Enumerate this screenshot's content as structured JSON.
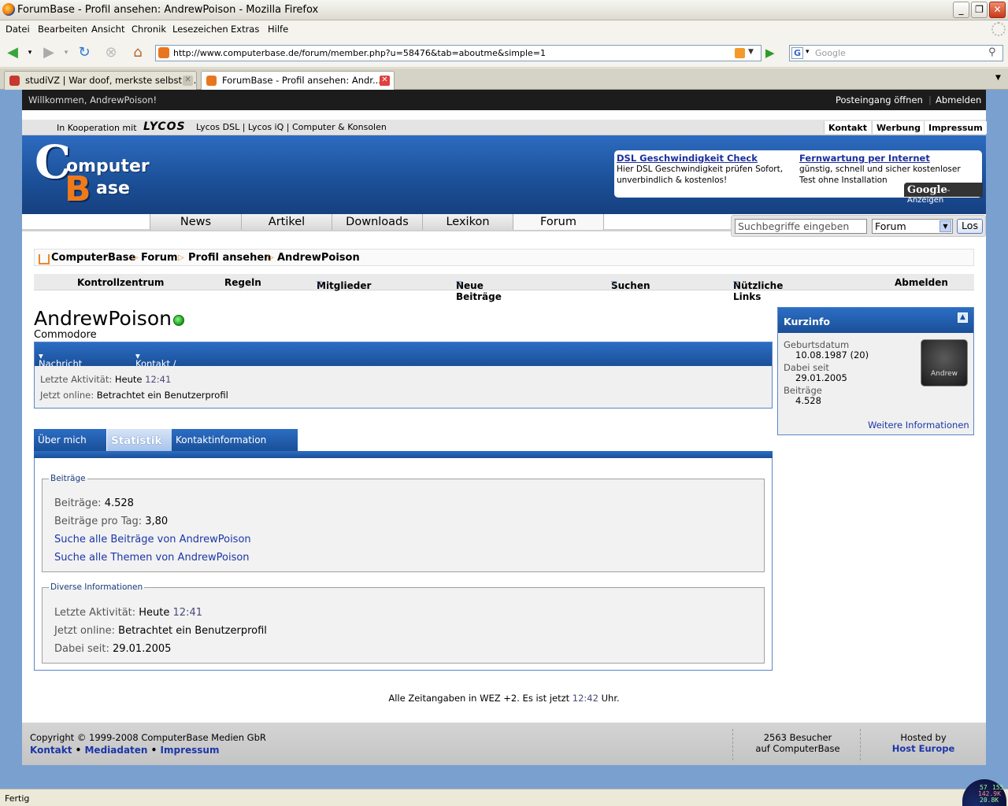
{
  "window": {
    "title": "ForumBase - Profil ansehen: AndrewPoison - Mozilla Firefox"
  },
  "menu": [
    "Datei",
    "Bearbeiten",
    "Ansicht",
    "Chronik",
    "Lesezeichen",
    "Extras",
    "Hilfe"
  ],
  "toolbar": {
    "url": "http://www.computerbase.de/forum/member.php?u=58476&tab=aboutme&simple=1",
    "search_placeholder": "Google"
  },
  "tabs": [
    {
      "label": "studiVZ | War doof, merkste selbst, n...",
      "active": false
    },
    {
      "label": "ForumBase - Profil ansehen: Andr...",
      "active": true
    }
  ],
  "site": {
    "welcome": "Willkommen, AndrewPoison!",
    "welcome_links": [
      "Posteingang öffnen",
      "Abmelden"
    ],
    "coop_prefix": "In Kooperation mit",
    "coop_brand": "LYCOS",
    "coop_links": "Lycos DSL | Lycos iQ | Computer & Konsolen",
    "corner_links": [
      "Kontakt",
      "Werbung",
      "Impressum"
    ],
    "logo": {
      "c": "C",
      "omputer": "omputer",
      "b": "B",
      "ase": "ase"
    },
    "ads": [
      {
        "title": "DSL Geschwindigkeit Check",
        "text1": "Hier DSL Geschwindigkeit prüfen Sofort,",
        "text2": "unverbindlich & kostenlos!"
      },
      {
        "title": "Fernwartung per Internet",
        "text1": "günstig, schnell und sicher kostenloser",
        "text2": "Test ohne Installation"
      }
    ],
    "google_ads": {
      "brand": "Google",
      "label": "-Anzeigen"
    },
    "main_nav": [
      "News",
      "Artikel",
      "Downloads",
      "Lexikon",
      "Forum"
    ],
    "search": {
      "placeholder": "Suchbegriffe eingeben",
      "scope": "Forum",
      "button": "Los"
    },
    "breadcrumb": [
      "ComputerBase",
      "Forum",
      "Profil ansehen",
      "AndrewPoison"
    ],
    "forum_nav": [
      "Kontrollzentrum",
      "Regeln",
      "Mitglieder",
      "Neue Beiträge",
      "Suchen",
      "Nützliche Links",
      "Abmelden"
    ]
  },
  "profile": {
    "username": "AndrewPoison",
    "usertitle": "Commodore",
    "actions": [
      "Nachricht senden",
      "Kontakt / Ignorieren"
    ],
    "last_activity_label": "Letzte Aktivität:",
    "last_activity_day": "Heute",
    "last_activity_time": "12:41",
    "online_label": "Jetzt online:",
    "online_value": "Betrachtet ein Benutzerprofil",
    "tabs": [
      "Über mich",
      "Statistik",
      "Kontaktinformation"
    ],
    "stats": {
      "legend": "Beiträge",
      "posts_label": "Beiträge:",
      "posts": "4.528",
      "per_day_label": "Beiträge pro Tag:",
      "per_day": "3,80",
      "link_posts": "Suche alle Beiträge von AndrewPoison",
      "link_threads": "Suche alle Themen von AndrewPoison"
    },
    "misc": {
      "legend": "Diverse Informationen",
      "activity_label": "Letzte Aktivität:",
      "activity_day": "Heute",
      "activity_time": "12:41",
      "online_label": "Jetzt online:",
      "online_value": "Betrachtet ein Benutzerprofil",
      "joined_label": "Dabei seit:",
      "joined": "29.01.2005"
    }
  },
  "kurzinfo": {
    "title": "Kurzinfo",
    "birthday_label": "Geburtsdatum",
    "birthday": "10.08.1987 (20)",
    "joined_label": "Dabei seit",
    "joined": "29.01.2005",
    "posts_label": "Beiträge",
    "posts": "4.528",
    "avatar_text": "Andrew",
    "more": "Weitere Informationen"
  },
  "time_note": {
    "prefix": "Alle Zeitangaben in WEZ +2. Es ist jetzt",
    "time": "12:42",
    "suffix": "Uhr."
  },
  "footer": {
    "copyright": "Copyright © 1999-2008 ComputerBase Medien GbR",
    "links": [
      "Kontakt",
      "Mediadaten",
      "Impressum"
    ],
    "visitors1": "2563 Besucher",
    "visitors2": "auf ComputerBase",
    "hosted": "Hosted by",
    "host": "Host Europe"
  },
  "status": {
    "text": "Fertig",
    "meter": [
      "57",
      "155",
      "142.9K",
      "20.8K"
    ]
  },
  "colors": {
    "header_blue": "#1a4f98",
    "link": "#1b36a8",
    "accent_orange": "#f07a1a",
    "page_bg": "#7aa0d0"
  }
}
